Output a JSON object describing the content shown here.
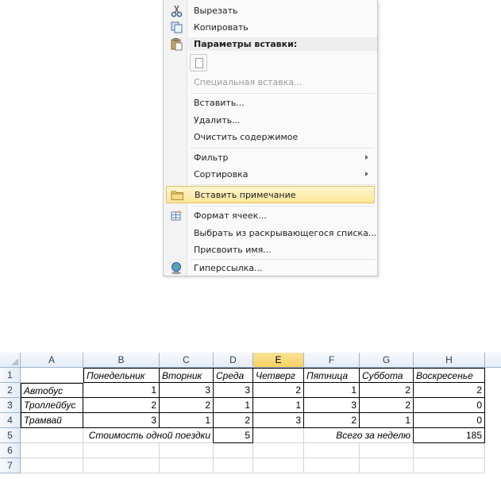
{
  "context_menu": {
    "cut": "Вырезать",
    "copy": "Копировать",
    "paste_options_header": "Параметры вставки:",
    "paste_special": "Специальная вставка...",
    "insert": "Вставить...",
    "delete": "Удалить...",
    "clear_contents": "Очистить содержимое",
    "filter": "Фильтр",
    "sort": "Сортировка",
    "insert_comment": "Вставить примечание",
    "format_cells": "Формат ячеек...",
    "pick_from_list": "Выбрать из раскрывающегося списка...",
    "define_name": "Присвоить имя...",
    "hyperlink": "Гиперссылка..."
  },
  "sheet": {
    "columns": [
      "A",
      "B",
      "C",
      "D",
      "E",
      "F",
      "G",
      "H"
    ],
    "selected_column": "E",
    "row_numbers": [
      "1",
      "2",
      "3",
      "4",
      "5",
      "6",
      "7"
    ],
    "header_row": [
      "",
      "Понедельник",
      "Вторник",
      "Среда",
      "Четверг",
      "Пятница",
      "Суббота",
      "Воскресенье"
    ],
    "rows": [
      {
        "label": "Автобус",
        "values": [
          "1",
          "3",
          "3",
          "2",
          "1",
          "2",
          "2"
        ]
      },
      {
        "label": "Троллейбус",
        "values": [
          "2",
          "2",
          "1",
          "1",
          "3",
          "2",
          "0"
        ]
      },
      {
        "label": "Трамвай",
        "values": [
          "3",
          "1",
          "2",
          "3",
          "2",
          "1",
          "0"
        ]
      }
    ],
    "cost_label": "Стоимость  одной поездки",
    "cost_value": "5",
    "week_total_label": "Всего за неделю",
    "week_total_value": "185"
  },
  "icon_colors": {
    "highlight": "#fde69a",
    "grid": "#d4d4d4",
    "header_border": "#9eb6ce"
  }
}
